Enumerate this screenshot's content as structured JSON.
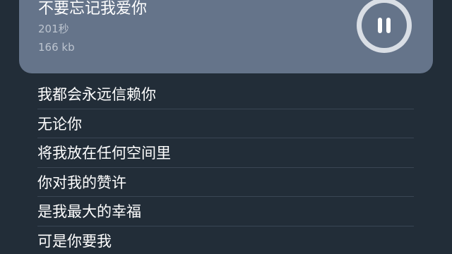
{
  "player": {
    "title": "不要忘记我爱你",
    "duration": "201秒",
    "size": "166 kb",
    "control_icon": "pause-icon",
    "colors": {
      "card": "#65748a",
      "background": "#222d38",
      "button_ring": "#d9dee5"
    }
  },
  "lyrics": [
    {
      "text": "我都会永远信赖你"
    },
    {
      "text": "无论你"
    },
    {
      "text": "将我放在任何空间里"
    },
    {
      "text": "你对我的赞许"
    },
    {
      "text": "是我最大的幸福"
    },
    {
      "text": "可是你要我"
    }
  ]
}
